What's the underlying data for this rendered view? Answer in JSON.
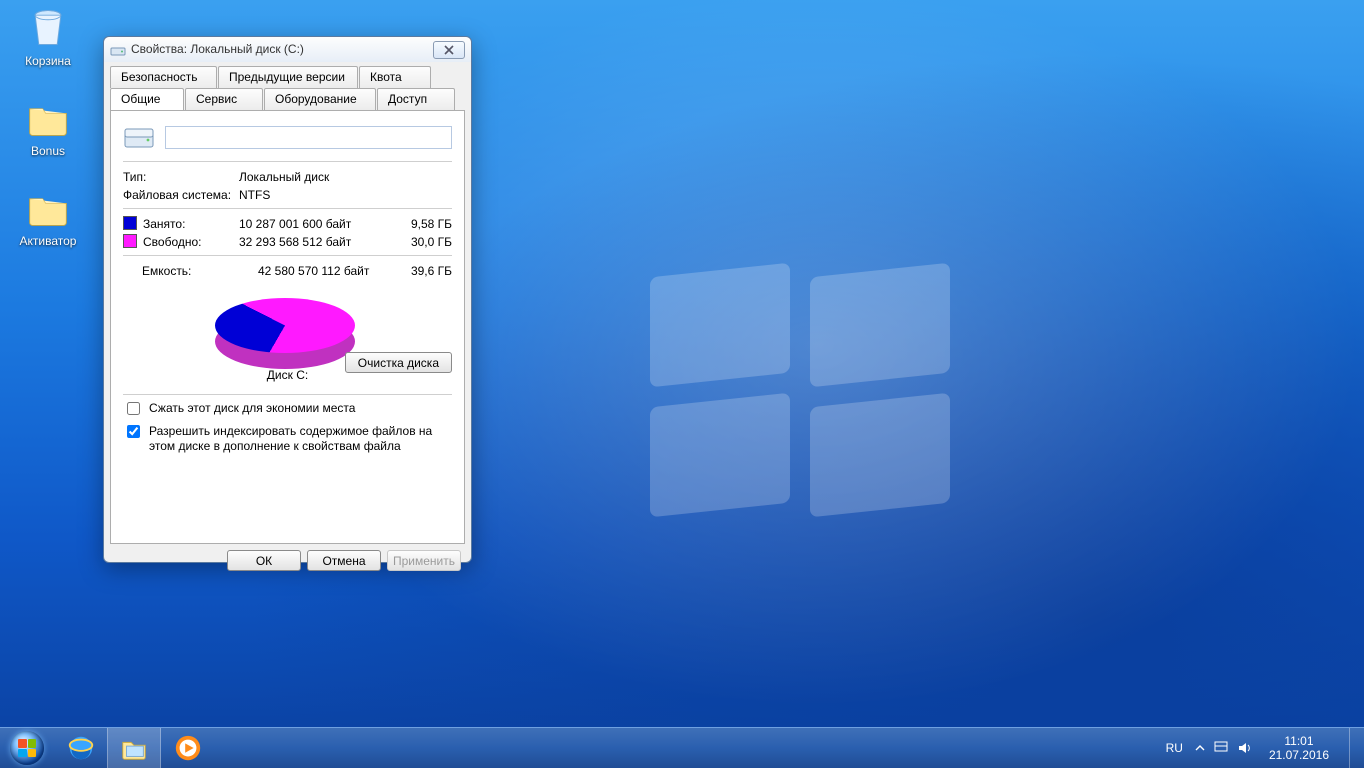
{
  "desktop": {
    "icons": [
      {
        "id": "recycle-bin",
        "label": "Корзина"
      },
      {
        "id": "bonus",
        "label": "Bonus"
      },
      {
        "id": "activator",
        "label": "Активатор"
      }
    ]
  },
  "window": {
    "title": "Свойства: Локальный диск (C:)",
    "tabs_row1": [
      "Безопасность",
      "Предыдущие версии",
      "Квота"
    ],
    "tabs_row2": [
      "Общие",
      "Сервис",
      "Оборудование",
      "Доступ"
    ],
    "active_tab": "Общие",
    "name_value": "",
    "type_label": "Тип:",
    "type_value": "Локальный диск",
    "fs_label": "Файловая система:",
    "fs_value": "NTFS",
    "used": {
      "label": "Занято:",
      "bytes": "10 287 001 600 байт",
      "human": "9,58 ГБ",
      "color": "#0000d6"
    },
    "free": {
      "label": "Свободно:",
      "bytes": "32 293 568 512 байт",
      "human": "30,0 ГБ",
      "color": "#ff19ff"
    },
    "capacity": {
      "label": "Емкость:",
      "bytes": "42 580 570 112 байт",
      "human": "39,6 ГБ"
    },
    "disk_label": "Диск C:",
    "cleanup_button": "Очистка диска",
    "checkbox_compress": {
      "checked": false,
      "label": "Сжать этот диск для экономии места"
    },
    "checkbox_index": {
      "checked": true,
      "label": "Разрешить индексировать содержимое файлов на этом диске в дополнение к свойствам файла"
    },
    "buttons": {
      "ok": "ОК",
      "cancel": "Отмена",
      "apply": "Применить"
    }
  },
  "taskbar": {
    "lang": "RU",
    "time": "11:01",
    "date": "21.07.2016"
  },
  "chart_data": {
    "type": "pie",
    "title": "Диск C:",
    "series": [
      {
        "name": "Занято",
        "value": 10287001600,
        "color": "#0000d6"
      },
      {
        "name": "Свободно",
        "value": 32293568512,
        "color": "#ff19ff"
      }
    ],
    "total": 42580570112
  }
}
